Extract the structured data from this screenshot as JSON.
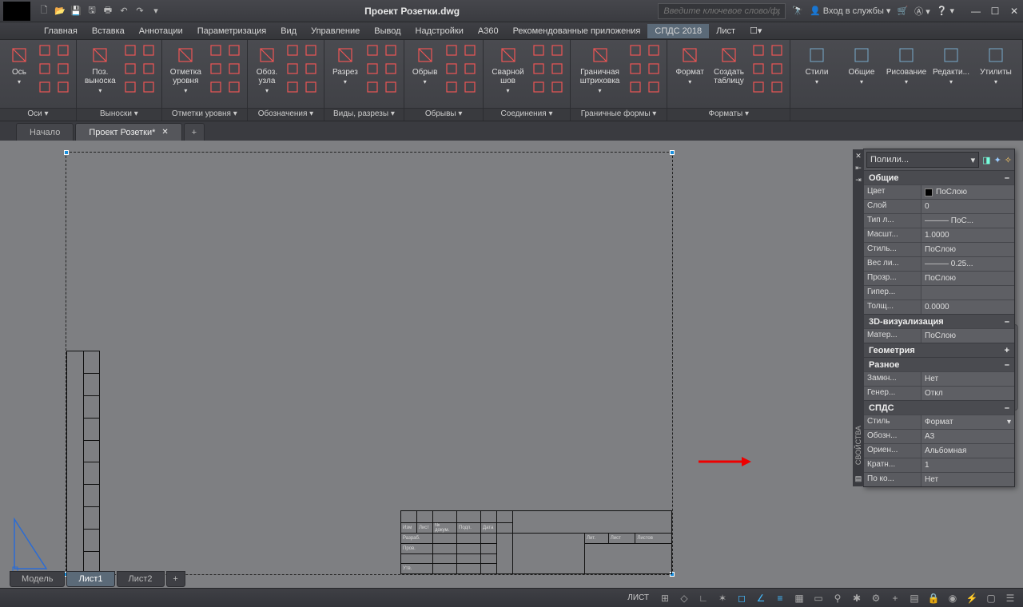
{
  "title": "Проект Розетки.dwg",
  "search_placeholder": "Введите ключевое слово/фразу",
  "signin": "Вход в службы",
  "menus": [
    "Главная",
    "Вставка",
    "Аннотации",
    "Параметризация",
    "Вид",
    "Управление",
    "Вывод",
    "Надстройки",
    "A360",
    "Рекомендованные приложения",
    "СПДС 2018",
    "Лист"
  ],
  "menu_active": 10,
  "ribbon_panels": [
    {
      "name": "Оси",
      "big": "Ось"
    },
    {
      "name": "Выноски",
      "big": "Поз. выноска"
    },
    {
      "name": "Отметки уровня",
      "big": "Отметка уровня"
    },
    {
      "name": "Обозначения",
      "big": "Обоз. узла"
    },
    {
      "name": "Виды, разрезы",
      "big": "Разрез"
    },
    {
      "name": "Обрывы",
      "big": "Обрыв"
    },
    {
      "name": "Соединения",
      "big": "Сварной шов"
    },
    {
      "name": "Граничные формы",
      "big": "Граничная штриховка"
    },
    {
      "name": "Форматы",
      "big": "Формат",
      "big2": "Создать таблицу"
    }
  ],
  "ribbon_right": [
    "Стили",
    "Общие",
    "Рисование",
    "Редакти...",
    "Утилиты"
  ],
  "doc_tabs": [
    "Начало",
    "Проект Розетки*"
  ],
  "doc_active": 1,
  "props": {
    "selector": "Полили...",
    "groups": [
      {
        "title": "Общие",
        "collapse": "–",
        "rows": [
          {
            "k": "Цвет",
            "v": "ПоСлою",
            "sw": "#000"
          },
          {
            "k": "Слой",
            "v": "0"
          },
          {
            "k": "Тип л...",
            "v": "——— ПоС..."
          },
          {
            "k": "Масшт...",
            "v": "1.0000"
          },
          {
            "k": "Стиль...",
            "v": "ПоСлою"
          },
          {
            "k": "Вес ли...",
            "v": "——— 0.25..."
          },
          {
            "k": "Прозр...",
            "v": "ПоСлою"
          },
          {
            "k": "Гипер...",
            "v": ""
          },
          {
            "k": "Толщ...",
            "v": "0.0000"
          }
        ]
      },
      {
        "title": "3D-визуализация",
        "collapse": "–",
        "rows": [
          {
            "k": "Матер...",
            "v": "ПоСлою"
          }
        ]
      },
      {
        "title": "Геометрия",
        "collapse": "+",
        "rows": []
      },
      {
        "title": "Разное",
        "collapse": "–",
        "rows": [
          {
            "k": "Замкн...",
            "v": "Нет"
          },
          {
            "k": "Генер...",
            "v": "Откл"
          }
        ]
      },
      {
        "title": "СПДС",
        "collapse": "–",
        "rows": [
          {
            "k": "Стиль",
            "v": "Формат",
            "dd": true
          },
          {
            "k": "Обозн...",
            "v": "A3"
          },
          {
            "k": "Ориен...",
            "v": "Альбомная"
          },
          {
            "k": "Кратн...",
            "v": "1"
          },
          {
            "k": "По ко...",
            "v": "Нет"
          }
        ]
      }
    ],
    "side_label": "СВОЙСТВА"
  },
  "view_tabs": [
    "Модель",
    "Лист1",
    "Лист2"
  ],
  "view_active": 1,
  "status_label": "ЛИСТ"
}
